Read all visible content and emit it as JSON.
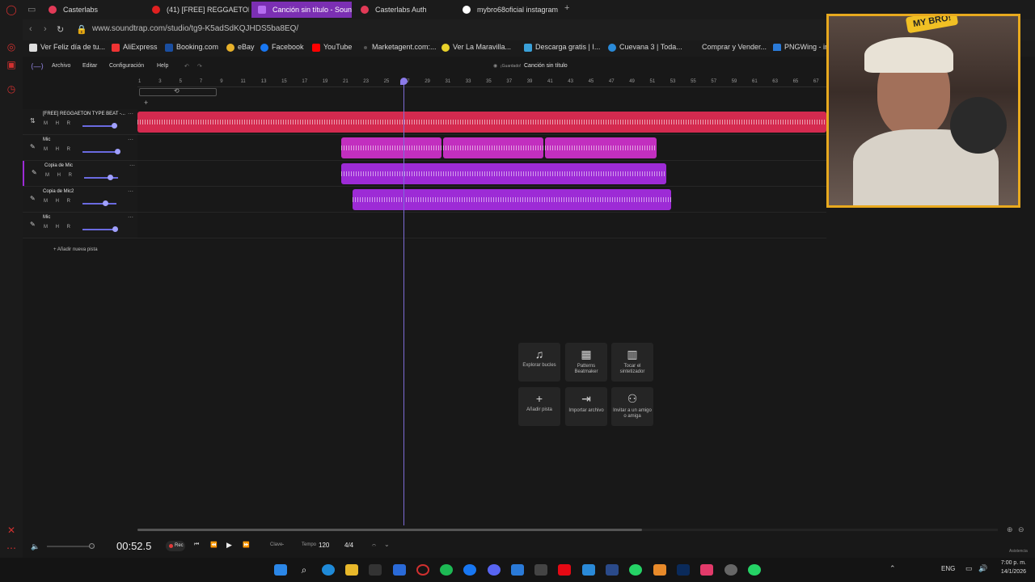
{
  "browser": {
    "tabs": [
      {
        "label": "Casterlabs",
        "active": false
      },
      {
        "label": "(41) [FREE] REGGAETON T",
        "active": false
      },
      {
        "label": "Canción sin título - Sound",
        "active": true
      },
      {
        "label": "Casterlabs Auth",
        "active": false
      },
      {
        "label": "mybro68oficial instagram",
        "active": false
      }
    ],
    "url": "www.soundtrap.com/studio/tg9-K5adSdKQJHDS5ba8EQ/",
    "bookmarks": [
      "Ver Feliz día de tu...",
      "AliExpress",
      "Booking.com",
      "eBay",
      "Facebook",
      "YouTube",
      "Marketagent.com:...",
      "Ver La Maravilla...",
      "Descarga gratis | I...",
      "Cuevana 3 | Toda...",
      "Comprar y Vender...",
      "PNGWing - in"
    ]
  },
  "app": {
    "menu": [
      "Archivo",
      "Editar",
      "Configuración",
      "Help"
    ],
    "save_status": "¡Guardado!",
    "project_title": "Canción sin título",
    "ruler_ticks": [
      "1",
      "3",
      "5",
      "7",
      "9",
      "11",
      "13",
      "15",
      "17",
      "19",
      "21",
      "23",
      "25",
      "27",
      "29",
      "31",
      "33",
      "35",
      "37",
      "39",
      "41",
      "43",
      "45",
      "47",
      "49",
      "51",
      "53",
      "55",
      "57",
      "59",
      "61",
      "63",
      "65",
      "67"
    ],
    "tracks": [
      {
        "name": "[FREE] REGGAETON TYPE BEAT -...",
        "color": "#d42a4f"
      },
      {
        "name": "Mic",
        "color": "#c22fbf"
      },
      {
        "name": "Copia de Mic",
        "color": "#9d2bd6"
      },
      {
        "name": "Copia de Mic2",
        "color": "#9d2bd6"
      },
      {
        "name": "Mic",
        "color": ""
      }
    ],
    "track_controls": "M H R",
    "add_track": "+ Añadir nueva pista",
    "tiles": [
      {
        "icon": "music-note-icon",
        "label": "Explorar bucles"
      },
      {
        "icon": "grid-icon",
        "label": "Patterns Beatmaker"
      },
      {
        "icon": "piano-icon",
        "label": "Tocar el sintetizador"
      },
      {
        "icon": "plus-icon",
        "label": "Añadir pista"
      },
      {
        "icon": "import-icon",
        "label": "Importar archivo"
      },
      {
        "icon": "invite-icon",
        "label": "Invitar a un amigo o amiga"
      }
    ],
    "transport": {
      "time": "00:52.5",
      "rec": "Rec",
      "key_label": "Clave",
      "key_value": "-",
      "tempo_label": "Tempo",
      "tempo_value": "120",
      "signature": "4/4",
      "assist": "Asistencia"
    }
  },
  "taskbar": {
    "lang": "ENG",
    "time": "7:00 p. m.",
    "date": "14/1/2026"
  },
  "webcam": {
    "badge": "MY BRO!"
  }
}
